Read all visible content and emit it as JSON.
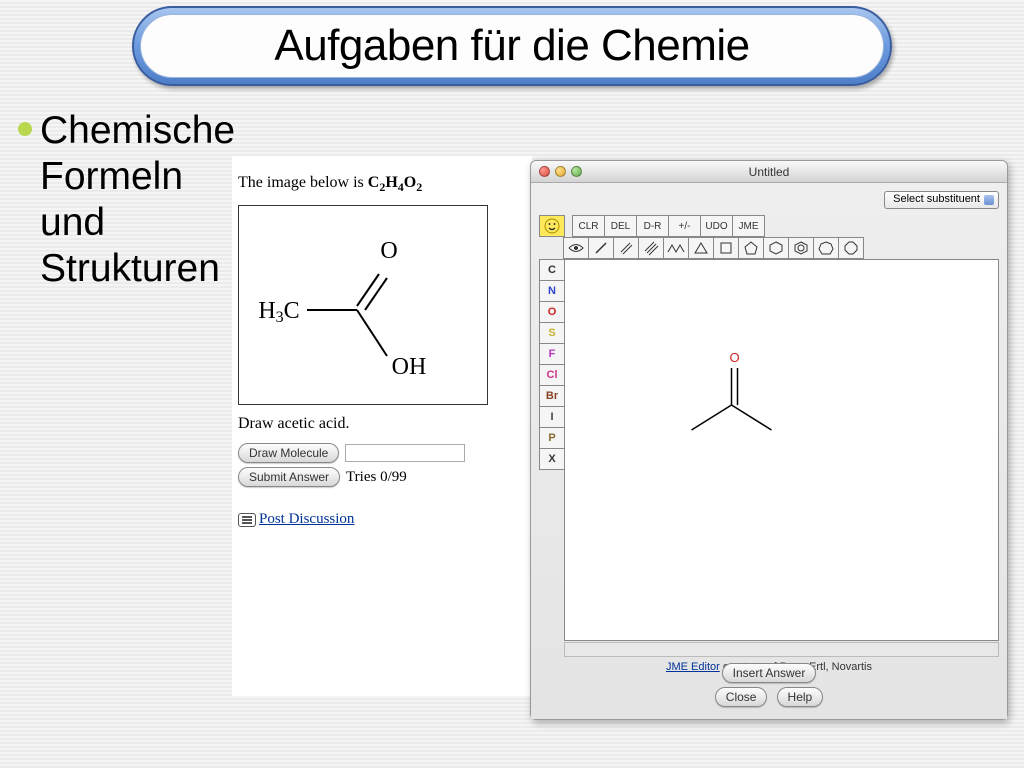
{
  "slide": {
    "title": "Aufgaben für die Chemie",
    "bullet": "Chemische Formeln und Strukturen"
  },
  "question": {
    "prefix": "The image below is ",
    "formula_plain": "C2H4O2",
    "structure": {
      "top_label": "O",
      "left_label": "H₃C",
      "bottom_label": "OH"
    },
    "task": "Draw acetic acid.",
    "draw_button": "Draw Molecule",
    "submit_button": "Submit Answer",
    "tries": "Tries 0/99",
    "post_discussion": "Post Discussion"
  },
  "editor": {
    "window_title": "Untitled",
    "select_label": "Select substituent",
    "top_tools": [
      "CLR",
      "DEL",
      "D-R",
      "+/-",
      "UDO",
      "JME"
    ],
    "elements": [
      "C",
      "N",
      "O",
      "S",
      "F",
      "Cl",
      "Br",
      "I",
      "P",
      "X"
    ],
    "canvas_atom": "O",
    "credit_link": "JME Editor",
    "credit_tail": " courtesy of Peter Ertl, Novartis",
    "insert_button": "Insert Answer",
    "close_button": "Close",
    "help_button": "Help"
  }
}
